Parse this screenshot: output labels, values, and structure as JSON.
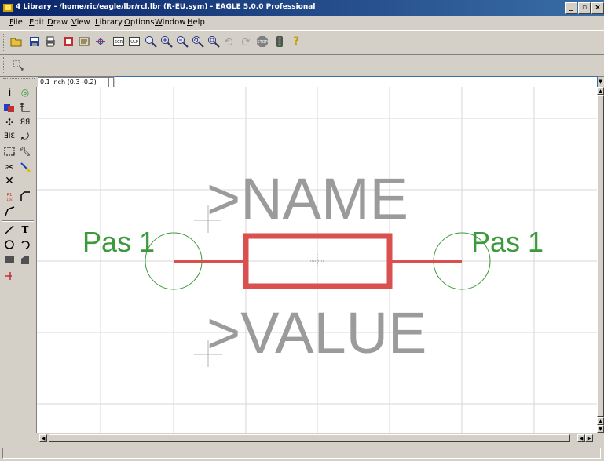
{
  "window": {
    "title": "4 Library - /home/ric/eagle/lbr/rcl.lbr (R-EU.sym) - EAGLE 5.0.0 Professional",
    "controls": [
      "_",
      "▫",
      "×"
    ]
  },
  "menu": [
    {
      "label": "File",
      "underline": "F",
      "rest": "ile"
    },
    {
      "label": "Edit",
      "underline": "E",
      "rest": "dit"
    },
    {
      "label": "Draw",
      "underline": "D",
      "rest": "raw"
    },
    {
      "label": "View",
      "underline": "V",
      "rest": "iew"
    },
    {
      "label": "Library",
      "underline": "L",
      "rest": "ibrary"
    },
    {
      "label": "Options",
      "underline": "O",
      "rest": "ptions"
    },
    {
      "label": "Window",
      "underline": "W",
      "rest": "indow"
    },
    {
      "label": "Help",
      "underline": "H",
      "rest": "elp"
    }
  ],
  "toolbar": {
    "icons": [
      "open-icon",
      "save-icon",
      "print-icon",
      "cam-icon",
      "script-icon",
      "ulp-icon",
      "scr-icon",
      "ulp2-icon",
      "zoom-fit-icon",
      "zoom-in-icon",
      "zoom-out-icon",
      "zoom-redraw-icon",
      "zoom-select-icon",
      "undo-icon",
      "redo-icon",
      "stop-icon",
      "go-icon",
      "help-icon"
    ],
    "stop_label": "STOP"
  },
  "command": {
    "coordinate": "0.1 inch (0.3 -0.2)",
    "value": "",
    "placeholder": ""
  },
  "left_tools": [
    [
      "info-icon",
      "show-icon"
    ],
    [
      "display-layers-icon",
      "mark-icon"
    ],
    [
      "move-icon",
      "copy-icon"
    ],
    [
      "mirror-icon",
      "rotate-icon"
    ],
    [
      "group-icon",
      "change-icon"
    ],
    [
      "cut-paste-icon",
      "paint-icon"
    ],
    [
      "delete-icon",
      ""
    ],
    [
      "name-icon",
      "miter-icon"
    ],
    [
      "split-icon",
      ""
    ],
    [
      "wire-icon",
      "text-icon"
    ],
    [
      "circle-icon",
      "arc-icon"
    ],
    [
      "rect-icon",
      "polygon-icon"
    ],
    [
      "pin-icon",
      ""
    ]
  ],
  "symbol": {
    "name_label": ">NAME",
    "value_label": ">VALUE",
    "pin_left": "Pas 1",
    "pin_right": "Pas 1",
    "colors": {
      "body": "#d9504f",
      "pin_text": "#3c9a3c",
      "pin_circle": "#3c9a3c",
      "label_text": "#9b9b9b",
      "grid": "#d7d7d7"
    }
  },
  "status": {
    "text": ""
  }
}
